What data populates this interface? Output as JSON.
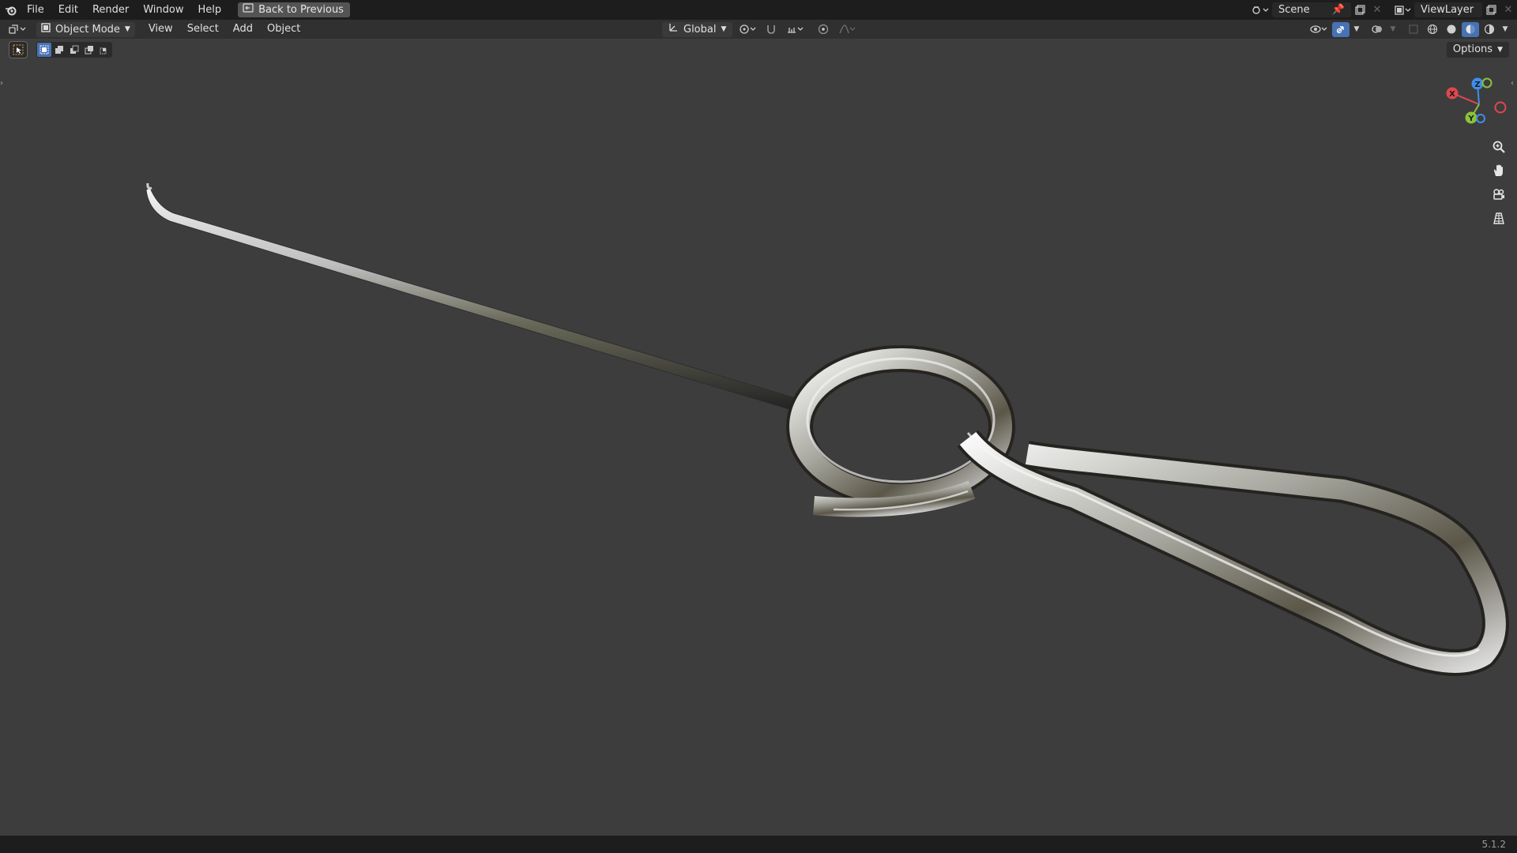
{
  "menubar": {
    "items": [
      "File",
      "Edit",
      "Render",
      "Window",
      "Help"
    ],
    "back_button": "Back to Previous"
  },
  "scene": {
    "name": "Scene"
  },
  "view_layer": {
    "name": "ViewLayer"
  },
  "header": {
    "mode": "Object Mode",
    "menus": [
      "View",
      "Select",
      "Add",
      "Object"
    ],
    "transform_orientation": "Global"
  },
  "viewport": {
    "options_label": "Options"
  },
  "gizmo": {
    "x": "X",
    "y": "Y",
    "z": "Z"
  },
  "status": {
    "version": "5.1.2"
  },
  "colors": {
    "background": "#3d3d3d",
    "accent": "#4772b3",
    "x_axis": "#e0474f",
    "y_axis": "#8ac33a",
    "z_axis": "#3f8ee9"
  }
}
